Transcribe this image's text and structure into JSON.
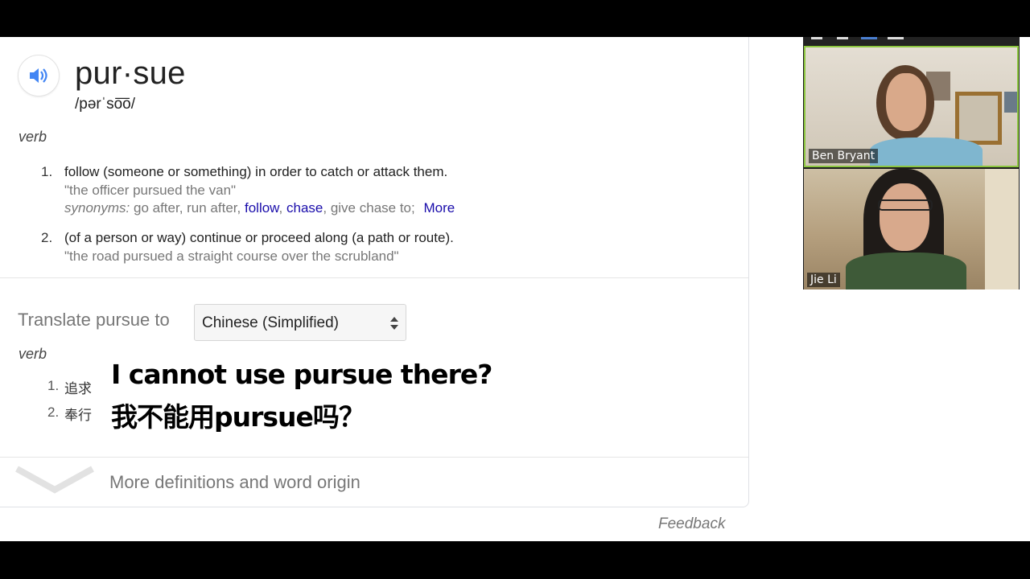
{
  "entry": {
    "headword": "pur·sue",
    "phonetic": "/pərˈso͞o/",
    "part_of_speech": "verb",
    "definitions": [
      {
        "number": "1.",
        "text": "follow (someone or something) in order to catch or attack them.",
        "example": "\"the officer pursued the van\"",
        "synonyms_label": "synonyms:",
        "synonyms_plain": "go after, run after,",
        "synonyms_links": [
          "follow",
          "chase"
        ],
        "synonyms_tail": "give chase to;",
        "more_label": "More"
      },
      {
        "number": "2.",
        "text": "(of a person or way) continue or proceed along (a path or route).",
        "example": "\"the road pursued a straight course over the scrubland\""
      }
    ]
  },
  "translate": {
    "label": "Translate pursue to",
    "selected_language": "Chinese (Simplified)",
    "part_of_speech": "verb",
    "items": [
      {
        "number": "1.",
        "word": "追求"
      },
      {
        "number": "2.",
        "word": "奉行"
      }
    ]
  },
  "more_definitions_label": "More definitions and word origin",
  "feedback_label": "Feedback",
  "subtitles": {
    "line1": "I cannot use pursue there?",
    "line2": "我不能用pursue吗？"
  },
  "video": {
    "participants": [
      {
        "name": "Ben Bryant",
        "active_speaker": true,
        "highlight_color": "#8cc63f"
      },
      {
        "name": "Jie Li",
        "active_speaker": false
      }
    ]
  },
  "colors": {
    "link": "#1a0dab",
    "speaker_icon": "#4285f4",
    "muted_text": "#777777"
  }
}
